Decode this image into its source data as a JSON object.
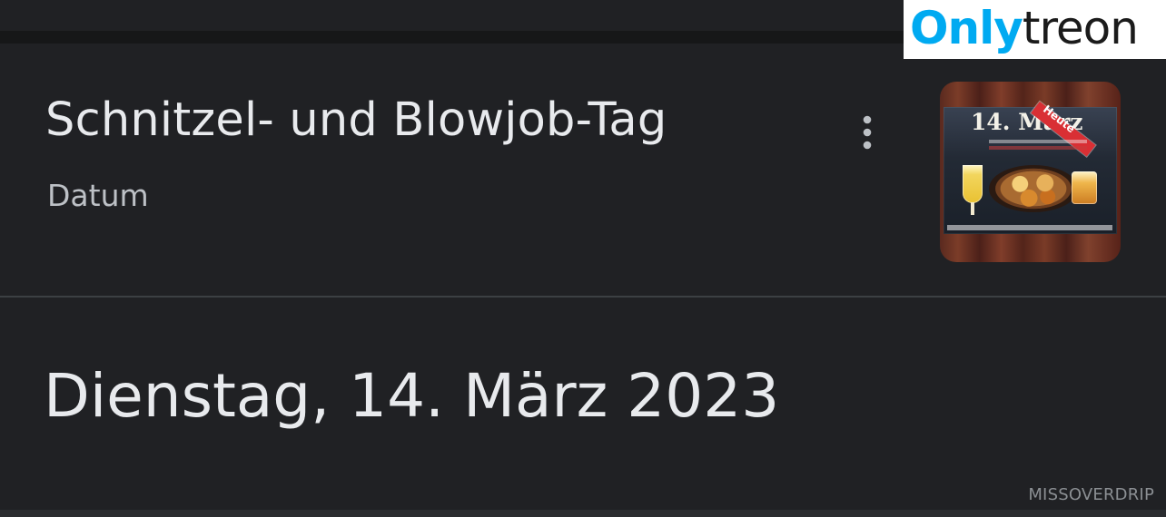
{
  "event": {
    "title": "Schnitzel- und Blowjob-Tag",
    "subtitle": "Datum",
    "menu_icon": "more-vert-icon",
    "image": {
      "heading": "14. März",
      "ribbon": "Heute"
    }
  },
  "date": {
    "value": "Dienstag, 14. März 2023"
  },
  "watermarks": {
    "logo_left": "Only",
    "logo_right": "treon",
    "bottom_right": "MISSOVERDRIP"
  },
  "colors": {
    "background": "#202124",
    "text_primary": "#e8eaed",
    "text_secondary": "#bdc1c6",
    "logo_accent": "#00aaf1"
  }
}
